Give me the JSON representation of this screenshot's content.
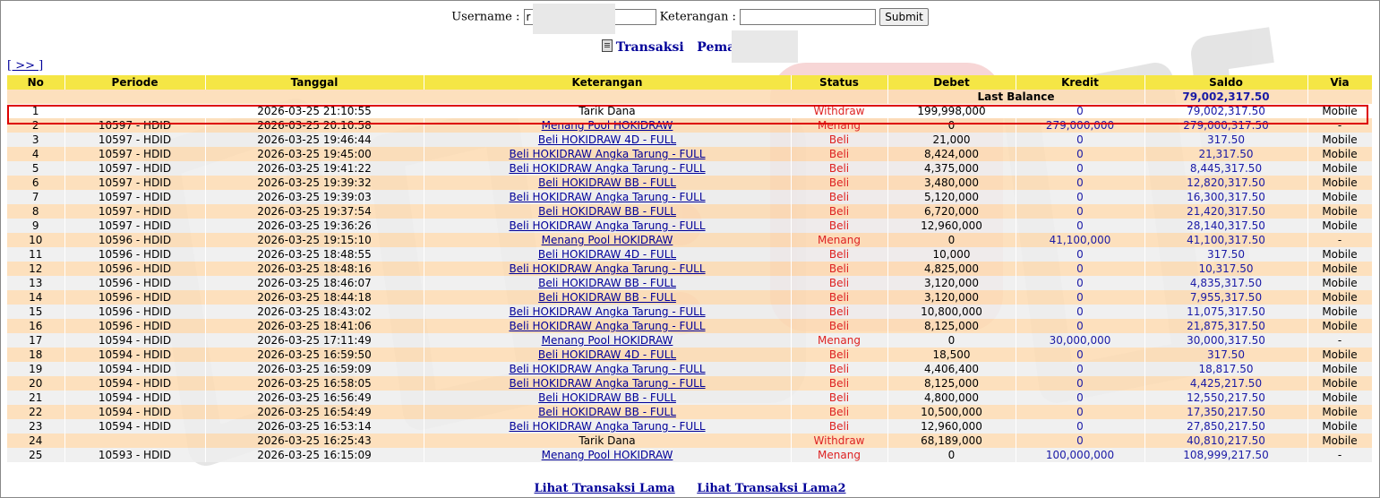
{
  "form": {
    "username_label": "Username :",
    "username_value": "r",
    "keterangan_label": "Keterangan :",
    "keterangan_value": "",
    "submit_label": "Submit"
  },
  "heading": {
    "title": "Transaksi",
    "player_label": "Pemain : ru"
  },
  "nav": {
    "next_label": "[ >> ]"
  },
  "table": {
    "headers": [
      "No",
      "Periode",
      "Tanggal",
      "Keterangan",
      "Status",
      "Debet",
      "Kredit",
      "Saldo",
      "Via"
    ],
    "last_balance_label": "Last Balance",
    "last_balance_value": "79,002,317.50",
    "rows": [
      {
        "no": "1",
        "periode": "",
        "tanggal": "2026-03-25 21:10:55",
        "keterangan": "Tarik Dana",
        "link": false,
        "status": "Withdraw",
        "debet": "199,998,000",
        "kredit": "0",
        "saldo": "79,002,317.50",
        "via": "Mobile"
      },
      {
        "no": "2",
        "periode": "10597 - HDID",
        "tanggal": "2026-03-25 20:10:58",
        "keterangan": "Menang Pool HOKIDRAW",
        "link": true,
        "status": "Menang",
        "debet": "0",
        "kredit": "279,000,000",
        "saldo": "279,000,317.50",
        "via": "-"
      },
      {
        "no": "3",
        "periode": "10597 - HDID",
        "tanggal": "2026-03-25 19:46:44",
        "keterangan": "Beli HOKIDRAW 4D - FULL",
        "link": true,
        "status": "Beli",
        "debet": "21,000",
        "kredit": "0",
        "saldo": "317.50",
        "via": "Mobile"
      },
      {
        "no": "4",
        "periode": "10597 - HDID",
        "tanggal": "2026-03-25 19:45:00",
        "keterangan": "Beli HOKIDRAW Angka Tarung - FULL",
        "link": true,
        "status": "Beli",
        "debet": "8,424,000",
        "kredit": "0",
        "saldo": "21,317.50",
        "via": "Mobile"
      },
      {
        "no": "5",
        "periode": "10597 - HDID",
        "tanggal": "2026-03-25 19:41:22",
        "keterangan": "Beli HOKIDRAW Angka Tarung - FULL",
        "link": true,
        "status": "Beli",
        "debet": "4,375,000",
        "kredit": "0",
        "saldo": "8,445,317.50",
        "via": "Mobile"
      },
      {
        "no": "6",
        "periode": "10597 - HDID",
        "tanggal": "2026-03-25 19:39:32",
        "keterangan": "Beli HOKIDRAW BB - FULL",
        "link": true,
        "status": "Beli",
        "debet": "3,480,000",
        "kredit": "0",
        "saldo": "12,820,317.50",
        "via": "Mobile"
      },
      {
        "no": "7",
        "periode": "10597 - HDID",
        "tanggal": "2026-03-25 19:39:03",
        "keterangan": "Beli HOKIDRAW Angka Tarung - FULL",
        "link": true,
        "status": "Beli",
        "debet": "5,120,000",
        "kredit": "0",
        "saldo": "16,300,317.50",
        "via": "Mobile"
      },
      {
        "no": "8",
        "periode": "10597 - HDID",
        "tanggal": "2026-03-25 19:37:54",
        "keterangan": "Beli HOKIDRAW BB - FULL",
        "link": true,
        "status": "Beli",
        "debet": "6,720,000",
        "kredit": "0",
        "saldo": "21,420,317.50",
        "via": "Mobile"
      },
      {
        "no": "9",
        "periode": "10597 - HDID",
        "tanggal": "2026-03-25 19:36:26",
        "keterangan": "Beli HOKIDRAW Angka Tarung - FULL",
        "link": true,
        "status": "Beli",
        "debet": "12,960,000",
        "kredit": "0",
        "saldo": "28,140,317.50",
        "via": "Mobile"
      },
      {
        "no": "10",
        "periode": "10596 - HDID",
        "tanggal": "2026-03-25 19:15:10",
        "keterangan": "Menang Pool HOKIDRAW",
        "link": true,
        "status": "Menang",
        "debet": "0",
        "kredit": "41,100,000",
        "saldo": "41,100,317.50",
        "via": "-"
      },
      {
        "no": "11",
        "periode": "10596 - HDID",
        "tanggal": "2026-03-25 18:48:55",
        "keterangan": "Beli HOKIDRAW 4D - FULL",
        "link": true,
        "status": "Beli",
        "debet": "10,000",
        "kredit": "0",
        "saldo": "317.50",
        "via": "Mobile"
      },
      {
        "no": "12",
        "periode": "10596 - HDID",
        "tanggal": "2026-03-25 18:48:16",
        "keterangan": "Beli HOKIDRAW Angka Tarung - FULL",
        "link": true,
        "status": "Beli",
        "debet": "4,825,000",
        "kredit": "0",
        "saldo": "10,317.50",
        "via": "Mobile"
      },
      {
        "no": "13",
        "periode": "10596 - HDID",
        "tanggal": "2026-03-25 18:46:07",
        "keterangan": "Beli HOKIDRAW BB - FULL",
        "link": true,
        "status": "Beli",
        "debet": "3,120,000",
        "kredit": "0",
        "saldo": "4,835,317.50",
        "via": "Mobile"
      },
      {
        "no": "14",
        "periode": "10596 - HDID",
        "tanggal": "2026-03-25 18:44:18",
        "keterangan": "Beli HOKIDRAW BB - FULL",
        "link": true,
        "status": "Beli",
        "debet": "3,120,000",
        "kredit": "0",
        "saldo": "7,955,317.50",
        "via": "Mobile"
      },
      {
        "no": "15",
        "periode": "10596 - HDID",
        "tanggal": "2026-03-25 18:43:02",
        "keterangan": "Beli HOKIDRAW Angka Tarung - FULL",
        "link": true,
        "status": "Beli",
        "debet": "10,800,000",
        "kredit": "0",
        "saldo": "11,075,317.50",
        "via": "Mobile"
      },
      {
        "no": "16",
        "periode": "10596 - HDID",
        "tanggal": "2026-03-25 18:41:06",
        "keterangan": "Beli HOKIDRAW Angka Tarung - FULL",
        "link": true,
        "status": "Beli",
        "debet": "8,125,000",
        "kredit": "0",
        "saldo": "21,875,317.50",
        "via": "Mobile"
      },
      {
        "no": "17",
        "periode": "10594 - HDID",
        "tanggal": "2026-03-25 17:11:49",
        "keterangan": "Menang Pool HOKIDRAW",
        "link": true,
        "status": "Menang",
        "debet": "0",
        "kredit": "30,000,000",
        "saldo": "30,000,317.50",
        "via": "-"
      },
      {
        "no": "18",
        "periode": "10594 - HDID",
        "tanggal": "2026-03-25 16:59:50",
        "keterangan": "Beli HOKIDRAW 4D - FULL",
        "link": true,
        "status": "Beli",
        "debet": "18,500",
        "kredit": "0",
        "saldo": "317.50",
        "via": "Mobile"
      },
      {
        "no": "19",
        "periode": "10594 - HDID",
        "tanggal": "2026-03-25 16:59:09",
        "keterangan": "Beli HOKIDRAW Angka Tarung - FULL",
        "link": true,
        "status": "Beli",
        "debet": "4,406,400",
        "kredit": "0",
        "saldo": "18,817.50",
        "via": "Mobile"
      },
      {
        "no": "20",
        "periode": "10594 - HDID",
        "tanggal": "2026-03-25 16:58:05",
        "keterangan": "Beli HOKIDRAW Angka Tarung - FULL",
        "link": true,
        "status": "Beli",
        "debet": "8,125,000",
        "kredit": "0",
        "saldo": "4,425,217.50",
        "via": "Mobile"
      },
      {
        "no": "21",
        "periode": "10594 - HDID",
        "tanggal": "2026-03-25 16:56:49",
        "keterangan": "Beli HOKIDRAW BB - FULL",
        "link": true,
        "status": "Beli",
        "debet": "4,800,000",
        "kredit": "0",
        "saldo": "12,550,217.50",
        "via": "Mobile"
      },
      {
        "no": "22",
        "periode": "10594 - HDID",
        "tanggal": "2026-03-25 16:54:49",
        "keterangan": "Beli HOKIDRAW BB - FULL",
        "link": true,
        "status": "Beli",
        "debet": "10,500,000",
        "kredit": "0",
        "saldo": "17,350,217.50",
        "via": "Mobile"
      },
      {
        "no": "23",
        "periode": "10594 - HDID",
        "tanggal": "2026-03-25 16:53:14",
        "keterangan": "Beli HOKIDRAW Angka Tarung - FULL",
        "link": true,
        "status": "Beli",
        "debet": "12,960,000",
        "kredit": "0",
        "saldo": "27,850,217.50",
        "via": "Mobile"
      },
      {
        "no": "24",
        "periode": "",
        "tanggal": "2026-03-25 16:25:43",
        "keterangan": "Tarik Dana",
        "link": false,
        "status": "Withdraw",
        "debet": "68,189,000",
        "kredit": "0",
        "saldo": "40,810,217.50",
        "via": "Mobile"
      },
      {
        "no": "25",
        "periode": "10593 - HDID",
        "tanggal": "2026-03-25 16:15:09",
        "keterangan": "Menang Pool HOKIDRAW",
        "link": true,
        "status": "Menang",
        "debet": "0",
        "kredit": "100,000,000",
        "saldo": "108,999,217.50",
        "via": "-"
      }
    ]
  },
  "footer": {
    "link1": "Lihat Transaksi Lama",
    "link2": "Lihat Transaksi Lama2"
  },
  "colors": {
    "header_bg": "#f5e645",
    "row_odd": "#fddcb4",
    "row_even": "#eeeeee",
    "link": "#000099",
    "status_red": "#dd2222",
    "amount_blue": "#1a1aa6",
    "highlight_border": "#dd0000"
  },
  "icons": {
    "heading_icon": "document-icon",
    "watermark": "dice-logo-watermark"
  }
}
